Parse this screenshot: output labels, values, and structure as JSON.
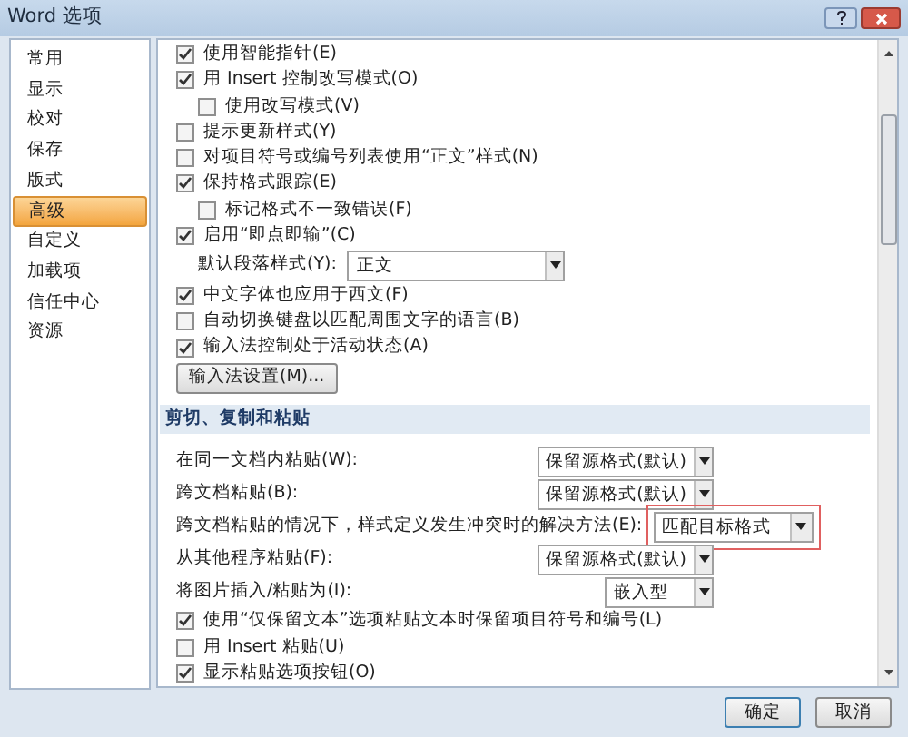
{
  "window": {
    "title": "Word 选项"
  },
  "sidebar": {
    "items": [
      {
        "label": "常用",
        "selected": false
      },
      {
        "label": "显示",
        "selected": false
      },
      {
        "label": "校对",
        "selected": false
      },
      {
        "label": "保存",
        "selected": false
      },
      {
        "label": "版式",
        "selected": false
      },
      {
        "label": "高级",
        "selected": true
      },
      {
        "label": "自定义",
        "selected": false
      },
      {
        "label": "加载项",
        "selected": false
      },
      {
        "label": "信任中心",
        "selected": false
      },
      {
        "label": "资源",
        "selected": false
      }
    ]
  },
  "options": [
    {
      "kind": "checkbox",
      "label": "使用智能指针(E)",
      "checked": true
    },
    {
      "kind": "checkbox",
      "label": "用 Insert 控制改写模式(O)",
      "checked": true,
      "children": [
        {
          "kind": "checkbox",
          "label": "使用改写模式(V)",
          "checked": false
        }
      ]
    },
    {
      "kind": "checkbox",
      "label": "提示更新样式(Y)",
      "checked": false
    },
    {
      "kind": "checkbox",
      "label": "对项目符号或编号列表使用“正文”样式(N)",
      "checked": false
    },
    {
      "kind": "checkbox",
      "label": "保持格式跟踪(E)",
      "checked": true,
      "children": [
        {
          "kind": "checkbox",
          "label": "标记格式不一致错误(F)",
          "checked": false
        }
      ]
    },
    {
      "kind": "checkbox",
      "label": "启用“即点即输”(C)",
      "checked": true,
      "children": [
        {
          "kind": "select",
          "label": "默认段落样式(Y):",
          "value": "正文"
        }
      ]
    },
    {
      "kind": "checkbox",
      "label": "中文字体也应用于西文(F)",
      "checked": true
    },
    {
      "kind": "checkbox",
      "label": "自动切换键盘以匹配周围文字的语言(B)",
      "checked": false
    },
    {
      "kind": "checkbox",
      "label": "输入法控制处于活动状态(A)",
      "checked": true
    },
    {
      "kind": "button",
      "label": "输入法设置(M)..."
    }
  ],
  "paste_section": {
    "title": "剪切、复制和粘贴",
    "rows": [
      {
        "kind": "select",
        "label": "在同一文档内粘贴(W):",
        "value": "保留源格式(默认)",
        "highlighted": false
      },
      {
        "kind": "select",
        "label": "跨文档粘贴(B):",
        "value": "保留源格式(默认)",
        "highlighted": false
      },
      {
        "kind": "select",
        "label": "跨文档粘贴的情况下，样式定义发生冲突时的解决方法(E):",
        "value": "匹配目标格式",
        "highlighted": true
      },
      {
        "kind": "select",
        "label": "从其他程序粘贴(F):",
        "value": "保留源格式(默认)",
        "highlighted": false
      },
      {
        "kind": "select",
        "label": "将图片插入/粘贴为(I):",
        "value": "嵌入型",
        "highlighted": false
      },
      {
        "kind": "checkbox",
        "label": "使用“仅保留文本”选项粘贴文本时保留项目符号和编号(L)",
        "checked": true
      },
      {
        "kind": "checkbox",
        "label": "用 Insert 粘贴(U)",
        "checked": false
      },
      {
        "kind": "checkbox",
        "label": "显示粘贴选项按钮(O)",
        "checked": true
      }
    ]
  },
  "buttons": [
    "确定",
    "取消"
  ]
}
